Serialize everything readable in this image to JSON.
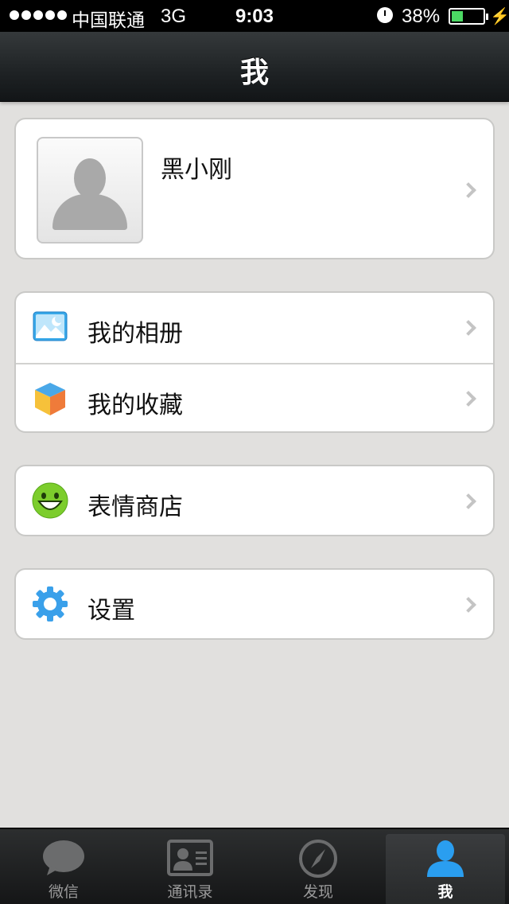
{
  "status_bar": {
    "carrier": "中国联通",
    "network": "3G",
    "time": "9:03",
    "battery_percent": "38%",
    "battery_level": 0.38,
    "signal_bars": 5
  },
  "nav": {
    "title": "我"
  },
  "profile": {
    "name": "黑小刚",
    "avatar_icon": "person-silhouette-icon"
  },
  "menu": {
    "album": {
      "label": "我的相册",
      "icon": "photo-album-icon"
    },
    "favorites": {
      "label": "我的收藏",
      "icon": "favorites-cube-icon"
    },
    "sticker_shop": {
      "label": "表情商店",
      "icon": "smiley-face-icon"
    },
    "settings": {
      "label": "设置",
      "icon": "gear-icon"
    }
  },
  "tabs": [
    {
      "label": "微信",
      "icon": "chat-bubble-icon",
      "active": false
    },
    {
      "label": "通讯录",
      "icon": "contacts-card-icon",
      "active": false
    },
    {
      "label": "发现",
      "icon": "compass-icon",
      "active": false
    },
    {
      "label": "我",
      "icon": "person-icon",
      "active": true
    }
  ],
  "colors": {
    "background": "#e1e0de",
    "nav_bar": "#1e2224",
    "battery_fill": "#4cd964",
    "active_tab_icon": "#2a9ef0"
  }
}
